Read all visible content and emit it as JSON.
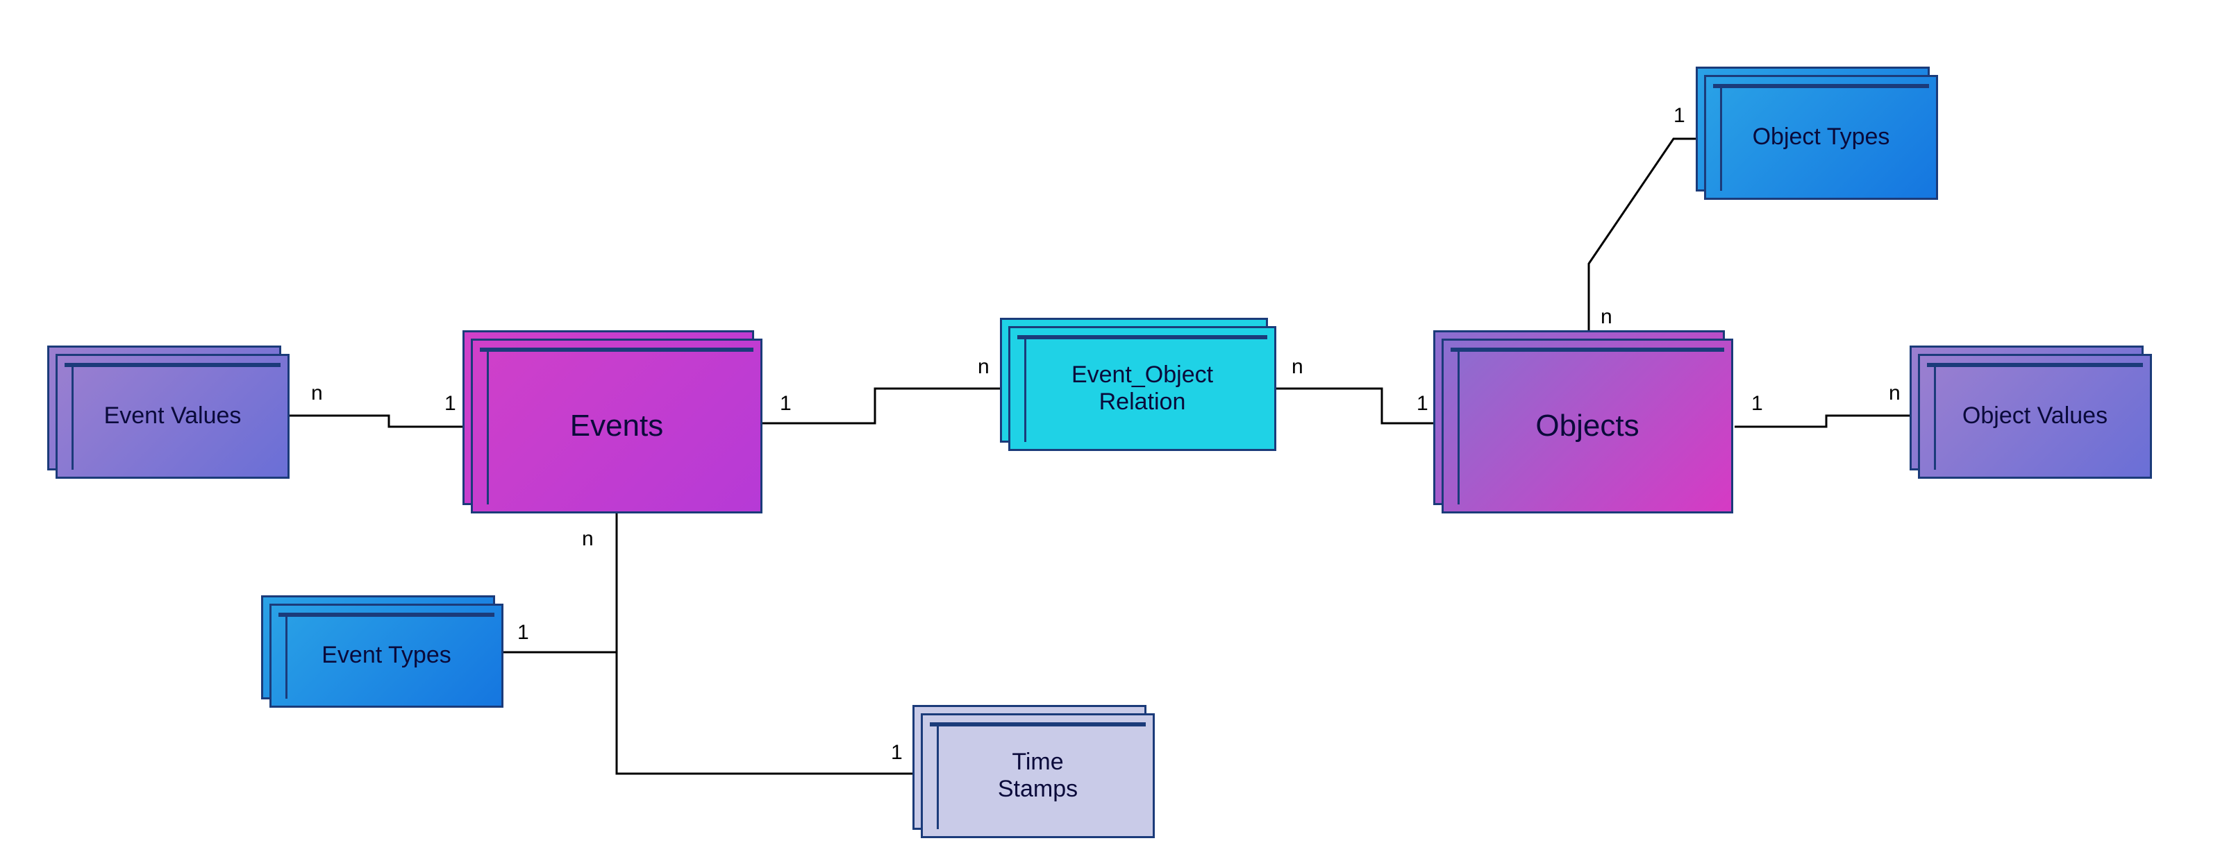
{
  "diagram": {
    "type": "entity-relationship",
    "entities": {
      "event_values": {
        "label": "Event Values"
      },
      "events": {
        "label": "Events"
      },
      "event_object_relation": {
        "label": "Event_Object\nRelation"
      },
      "objects": {
        "label": "Objects"
      },
      "object_types": {
        "label": "Object Types"
      },
      "object_values": {
        "label": "Object Values"
      },
      "event_types": {
        "label": "Event Types"
      },
      "time_stamps": {
        "label": "Time\nStamps"
      }
    },
    "cardinality": {
      "n": "n",
      "one": "1"
    },
    "relations": [
      {
        "from": "event_values",
        "from_card": "n",
        "to": "events",
        "to_card": "1"
      },
      {
        "from": "events",
        "from_card": "1",
        "to": "event_object_relation",
        "to_card": "n"
      },
      {
        "from": "event_object_relation",
        "from_card": "n",
        "to": "objects",
        "to_card": "1"
      },
      {
        "from": "objects",
        "from_card": "1",
        "to": "object_values",
        "to_card": "n"
      },
      {
        "from": "objects",
        "from_card": "n",
        "to": "object_types",
        "to_card": "1"
      },
      {
        "from": "events",
        "from_card": "n",
        "to": "event_types",
        "to_card": "1"
      },
      {
        "from": "events",
        "from_card": "n",
        "to": "time_stamps",
        "to_card": "1"
      }
    ],
    "colors": {
      "purple_gradient_a": "#9b7fd0",
      "purple_gradient_b": "#6a6fd6",
      "magenta_a": "#d040c9",
      "magenta_b": "#b63ad6",
      "cyan_solid": "#1fd2e6",
      "blue_a": "#2aa2e6",
      "blue_b": "#1576e0",
      "lavender": "#c9cbe8",
      "border": "#1b3b7a"
    }
  }
}
